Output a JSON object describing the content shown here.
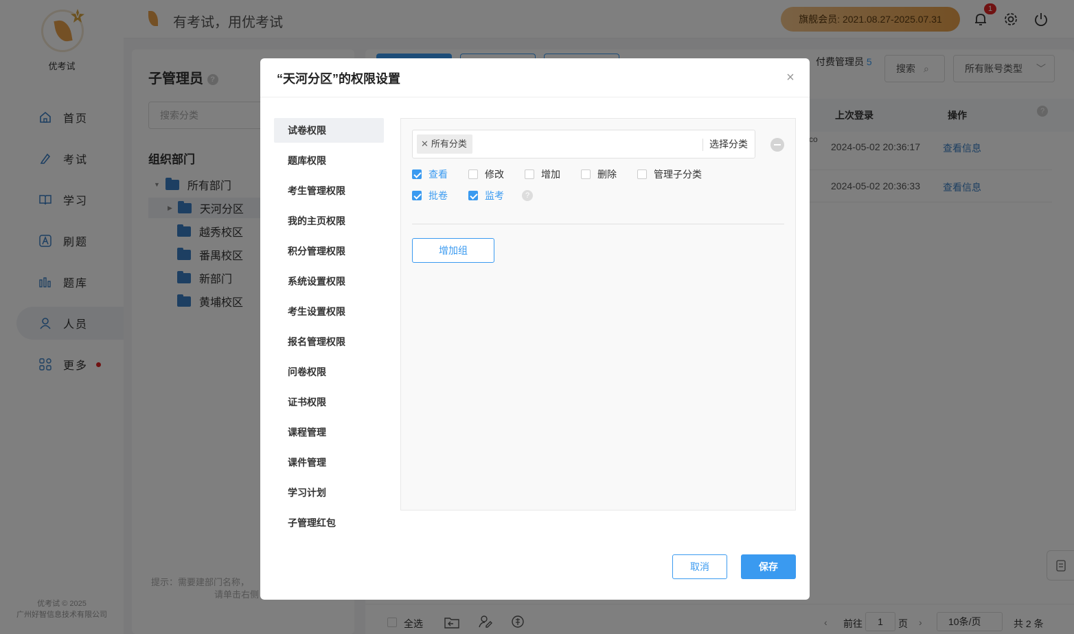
{
  "app": {
    "logo_text": "优考试",
    "slogan": "有考试，用优考试",
    "membership": "旗舰会员:  2021.08.27-2025.07.31",
    "notification_count": "1",
    "copyright_line1": "优考试 © 2025",
    "copyright_line2": "广州好智信息技术有限公司",
    "accent_color": "#3a9af0"
  },
  "nav": {
    "items": [
      {
        "label": "首页",
        "icon": "home-icon"
      },
      {
        "label": "考试",
        "icon": "exam-icon"
      },
      {
        "label": "学习",
        "icon": "book-icon"
      },
      {
        "label": "刷题",
        "icon": "practice-icon"
      },
      {
        "label": "题库",
        "icon": "bank-icon"
      },
      {
        "label": "人员",
        "icon": "user-icon"
      },
      {
        "label": "更多",
        "icon": "more-icon"
      }
    ],
    "active": "人员"
  },
  "left_panel": {
    "title": "子管理员",
    "search_placeholder": "搜索分类",
    "section": "组织部门",
    "tree": [
      "所有部门",
      "天河分区",
      "越秀校区",
      "番禺校区",
      "新部门",
      "黄埔校区"
    ],
    "tip_line1": "提示：需要建部门名称，",
    "tip_line2": "请单击右侧"
  },
  "main_panel": {
    "paid_label": "付费管理员",
    "paid_count": "5",
    "search_label": "搜索",
    "account_type": "所有账号类型",
    "columns": [
      "上次登录",
      "操作"
    ],
    "rows": [
      {
        "last_login": "2024-05-02 20:36:17",
        "action": "查看信息"
      },
      {
        "last_login": "2024-05-02 20:36:33",
        "action": "查看信息"
      }
    ],
    "cropped_text": "co",
    "select_all": "全选",
    "page_prefix": "前往",
    "page_value": "1",
    "page_suffix": "页",
    "page_size": "10条/页",
    "total": "共 2 条"
  },
  "modal": {
    "title": "“天河分区”的权限设置",
    "menu": [
      "试卷权限",
      "题库权限",
      "考生管理权限",
      "我的主页权限",
      "积分管理权限",
      "系统设置权限",
      "考生设置权限",
      "报名管理权限",
      "问卷权限",
      "证书权限",
      "课程管理",
      "课件管理",
      "学习计划",
      "子管理红包"
    ],
    "active_menu": "试卷权限",
    "category_tag": "所有分类",
    "select_category": "选择分类",
    "permissions": [
      {
        "label": "查看",
        "checked": true
      },
      {
        "label": "修改",
        "checked": false
      },
      {
        "label": "增加",
        "checked": false
      },
      {
        "label": "删除",
        "checked": false
      },
      {
        "label": "管理子分类",
        "checked": false
      },
      {
        "label": "批卷",
        "checked": true
      },
      {
        "label": "监考",
        "checked": true
      }
    ],
    "add_group": "增加组",
    "cancel": "取消",
    "save": "保存"
  }
}
